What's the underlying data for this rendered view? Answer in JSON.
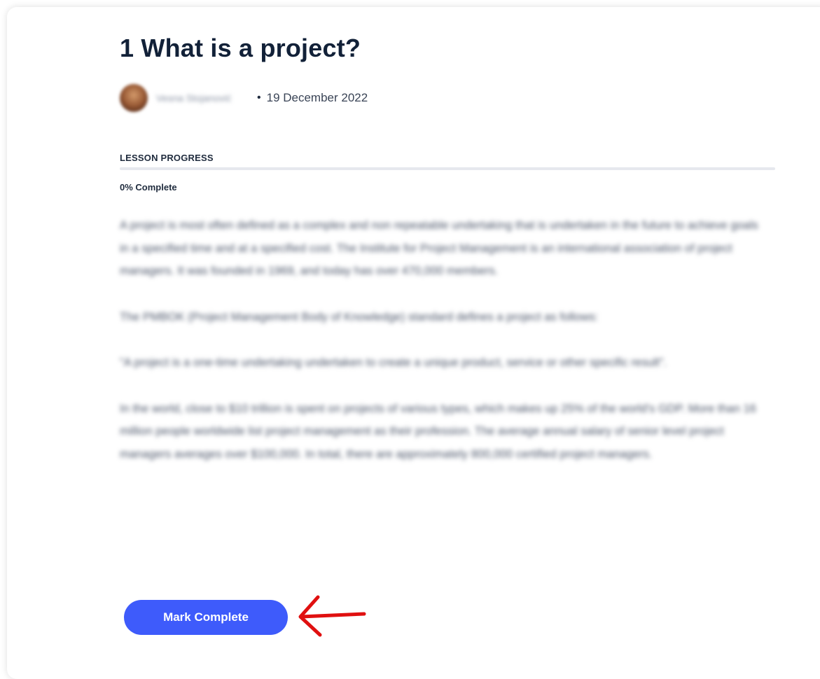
{
  "lesson": {
    "title": "1 What is a project?",
    "author_name": "Vesna Stojanović",
    "separator": "•",
    "date": "19 December 2022"
  },
  "progress": {
    "label": "LESSON PROGRESS",
    "percent": 0,
    "status_text": "0% Complete"
  },
  "body": {
    "paragraphs": [
      "A project is most often defined as a complex and non repeatable undertaking that is undertaken in the future to achieve goals in a specified time and at a specified cost. The Institute for Project Management is an international association of project managers. It was founded in 1969, and today has over 470,000 members.",
      "The PMBOK (Project Management Body of Knowledge) standard defines a project as follows:",
      "\"A project is a one-time undertaking undertaken to create a unique product, service or other specific result\".",
      "In the world, close to $10 trillion is spent on projects of various types, which makes up 25% of the world's GDP. More than 16 million people worldwide list project management as their profession. The average annual salary of senior level project managers averages over $100,000. In total, there are approximately 800,000 certified project managers."
    ]
  },
  "actions": {
    "mark_complete_label": "Mark Complete"
  },
  "colors": {
    "accent": "#3e5bfb",
    "title": "#122138",
    "annotation_arrow": "#e01010"
  },
  "icons": {
    "avatar": "author-avatar",
    "annotation": "red-arrow-left-icon"
  }
}
